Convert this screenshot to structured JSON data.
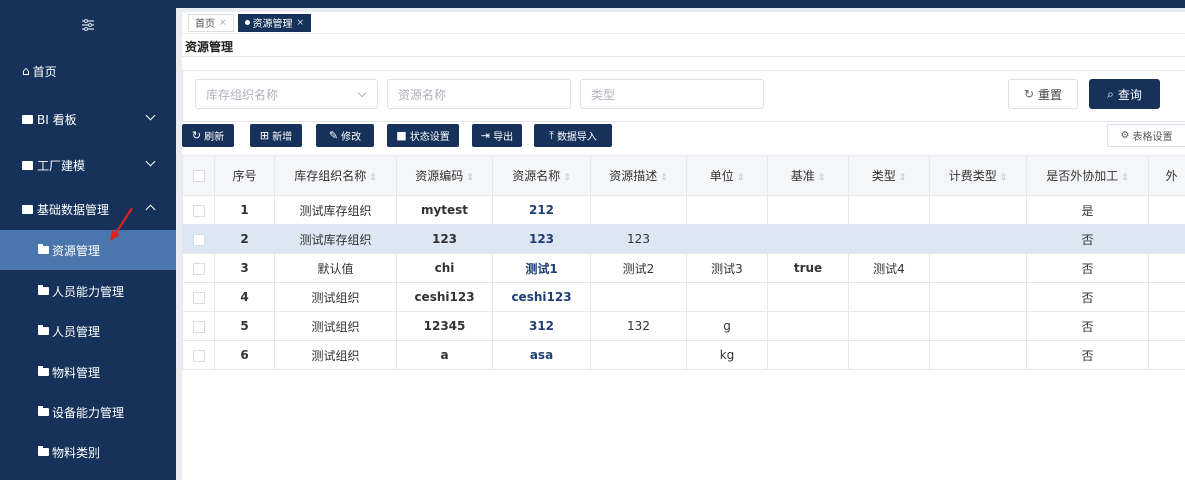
{
  "sidebar": {
    "toggle_icon": "menu-toggle-icon",
    "items": [
      {
        "label": "首页",
        "icon": "home-icon"
      },
      {
        "label": "BI 看板",
        "icon": "folder-icon"
      },
      {
        "label": "工厂建模",
        "icon": "folder-icon"
      },
      {
        "label": "基础数据管理",
        "icon": "folder-icon"
      }
    ],
    "subitems": [
      {
        "label": "资源管理",
        "active": true
      },
      {
        "label": "人员能力管理"
      },
      {
        "label": "人员管理"
      },
      {
        "label": "物料管理"
      },
      {
        "label": "设备能力管理"
      },
      {
        "label": "物料类别"
      }
    ]
  },
  "tabs": [
    {
      "label": "首页"
    },
    {
      "label": "资源管理",
      "active": true
    }
  ],
  "page_title": "资源管理",
  "search": {
    "org_placeholder": "库存组织名称",
    "name_placeholder": "资源名称",
    "type_placeholder": "类型",
    "reset_label": "重置",
    "query_label": "查询"
  },
  "toolbar": {
    "refresh": "刷新",
    "add": "新增",
    "edit": "修改",
    "status": "状态设置",
    "export": "导出",
    "import": "数据导入",
    "table_settings": "表格设置"
  },
  "table": {
    "headers": [
      "序号",
      "库存组织名称",
      "资源编码",
      "资源名称",
      "资源描述",
      "单位",
      "基准",
      "类型",
      "计费类型",
      "是否外协加工",
      "外"
    ],
    "rows": [
      [
        "1",
        "测试库存组织",
        "mytest",
        "212",
        "",
        "",
        "",
        "",
        "",
        "是"
      ],
      [
        "2",
        "测试库存组织",
        "123",
        "123",
        "123",
        "",
        "",
        "",
        "",
        "否"
      ],
      [
        "3",
        "默认值",
        "chi",
        "测试1",
        "测试2",
        "测试3",
        "true",
        "测试4",
        "",
        "否"
      ],
      [
        "4",
        "测试组织",
        "ceshi123",
        "ceshi123",
        "",
        "",
        "",
        "",
        "",
        "否"
      ],
      [
        "5",
        "测试组织",
        "12345",
        "312",
        "132",
        "g",
        "",
        "",
        "",
        "否"
      ],
      [
        "6",
        "测试组织",
        "a",
        "asa",
        "",
        "kg",
        "",
        "",
        "",
        "否"
      ]
    ]
  },
  "colors": {
    "primary": "#16325a",
    "active_sub": "#4b76ad",
    "highlight_row": "#dde7f4"
  }
}
